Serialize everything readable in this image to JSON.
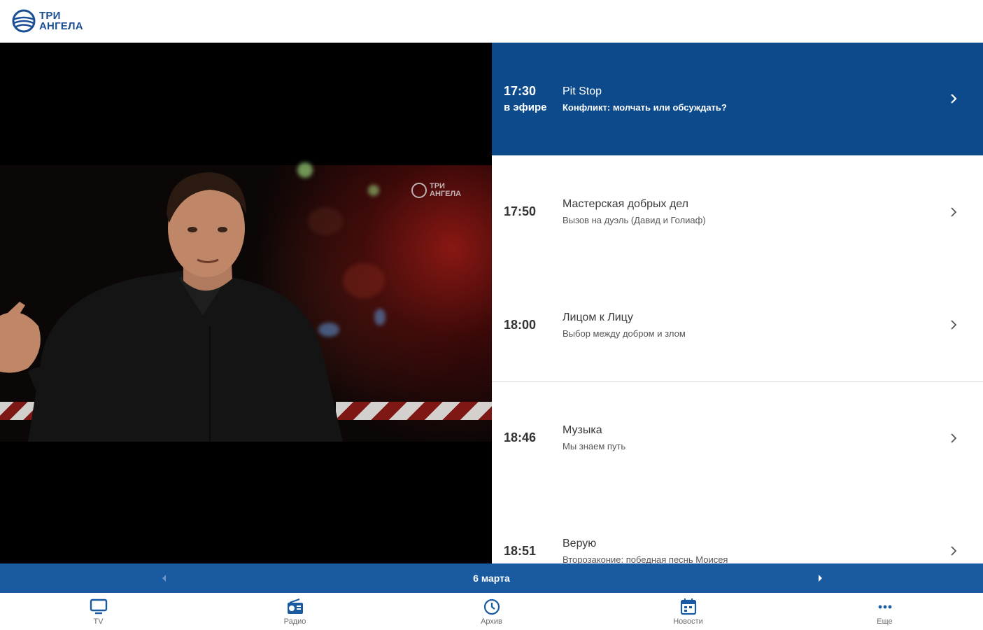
{
  "app": {
    "logo_line1": "ТРИ",
    "logo_line2": "АНГЕЛА"
  },
  "video": {
    "watermark_line1": "ТРИ",
    "watermark_line2": "АНГЕЛА"
  },
  "schedule": {
    "items": [
      {
        "time": "17:30",
        "status": "в эфире",
        "title": "Pit Stop",
        "subtitle": "Конфликт: молчать или обсуждать?",
        "active": true
      },
      {
        "time": "17:50",
        "title": "Мастерская добрых дел",
        "subtitle": "Вызов на дуэль (Давид и Голиаф)"
      },
      {
        "time": "18:00",
        "title": "Лицом к Лицу",
        "subtitle": "Выбор между добром и злом"
      },
      {
        "time": "18:46",
        "title": "Музыка",
        "subtitle": "Мы знаем путь"
      },
      {
        "time": "18:51",
        "title": "Верую",
        "subtitle": "Второзаконие: победная песнь Моисея"
      }
    ]
  },
  "datebar": {
    "date": "6 марта"
  },
  "nav": {
    "items": [
      {
        "label": "TV",
        "icon": "tv-icon"
      },
      {
        "label": "Радио",
        "icon": "radio-icon"
      },
      {
        "label": "Архив",
        "icon": "clock-icon"
      },
      {
        "label": "Новости",
        "icon": "calendar-icon"
      },
      {
        "label": "Еще",
        "icon": "more-icon"
      }
    ]
  },
  "colors": {
    "brand": "#1a5aa0",
    "active_row": "#0c4a8c"
  }
}
